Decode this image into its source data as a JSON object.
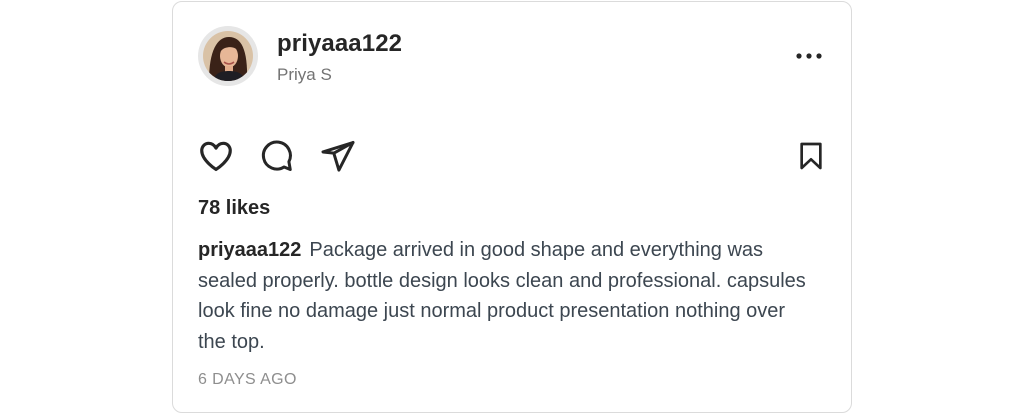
{
  "post": {
    "username": "priyaaa122",
    "full_name": "Priya S",
    "likes_text": "78 likes",
    "caption_user": "priyaaa122",
    "caption_text": "Package arrived in good shape and everything was sealed properly. bottle design looks clean and professional. capsules look fine no damage just normal product presentation nothing over the top.",
    "timestamp": "6 DAYS AGO"
  },
  "icons": {
    "more": "more-horizontal-icon",
    "like": "heart-icon",
    "comment": "comment-icon",
    "share": "send-icon",
    "save": "bookmark-icon"
  },
  "colors": {
    "text_primary": "#262626",
    "text_secondary": "#737373",
    "border": "#dbdbdb"
  }
}
